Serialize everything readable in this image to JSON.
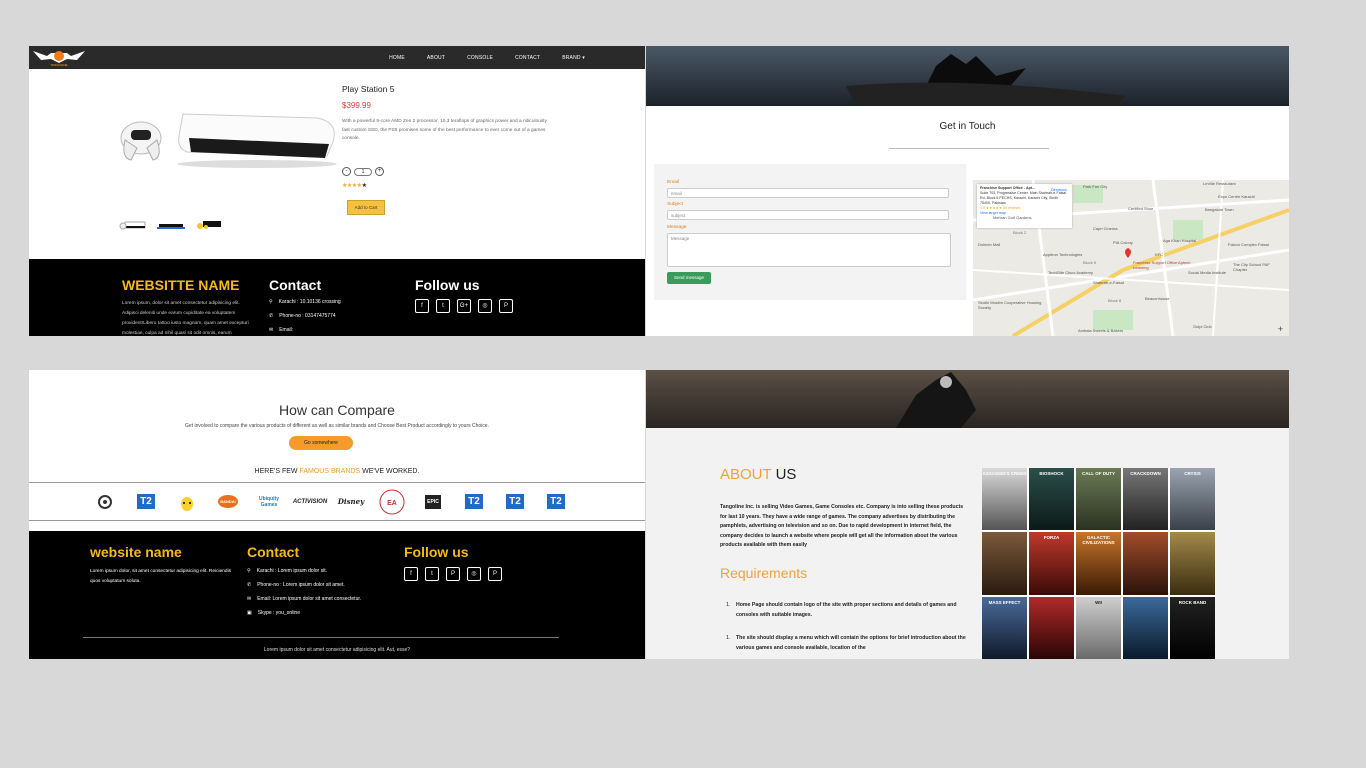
{
  "panel1": {
    "nav": [
      "HOME",
      "ABOUT",
      "CONSOLE",
      "CONTACT",
      "BRAND ▾"
    ],
    "logo_text": "TANGOLINE",
    "product": {
      "title": "Play Station 5",
      "price": "$399.99",
      "description": "With a powerful 8-core AMD Zen 2 processor, 10.3 teraflops of graphics power and a ridiculously fast custom SSD, the PS5 promises some of the best performance to ever come out of a games console.",
      "qty_minus": "-",
      "qty_value": "1",
      "qty_plus": "+",
      "rating": 4,
      "add_to_cart": "Add to Cart"
    },
    "footer": {
      "site_name": "WEBSITTE NAME",
      "about_text": "Lorem ipsum, dolor sit amet consectetur adipisicing elit. Adipisci deleniti unde earum cupiditate ea voluptatem provident!Libero tattoo iusto magnam, quam amet excepturi molestiae, culpa ad nihil quasi sit odit omnis, earum reprehenderit.",
      "contact_title": "Contact",
      "contact": [
        "Karachi : 10.10136 crossing",
        "Phone-no : 03147475774",
        "Email:"
      ],
      "follow_title": "Follow us"
    }
  },
  "panel2": {
    "heading": "Get in Touch",
    "form": {
      "email_label": "Email",
      "email_placeholder": "email",
      "subject_label": "Subject",
      "subject_placeholder": "subject",
      "message_label": "Message",
      "message_placeholder": "Message",
      "send": "Send message"
    },
    "map": {
      "card_title": "Franchise Support Office - Apt...",
      "card_address": "Suite 703, Progressive Center, Main Shahrah-e-Faisal Rd, Block 6 PECHS, Karachi, Karachi City, Sindh 75400, Pakistan",
      "card_rating": "4.9 ★★★★★  50 reviews",
      "card_link": "View larger map",
      "directions": "Directions",
      "labels": [
        "Park Fun City",
        "LeVille Restaurant",
        "Expo Centre Karachi",
        "Bangalore Town",
        "Certified Shoe",
        "Aga Khan Hospital",
        "Capri Cinema",
        "PIA Colony",
        "KFC",
        "Franchise Support Office Aptech Learning",
        "Falcon Complex Faisal",
        "Shahrah-e-Faisal",
        "Sindhi Muslim Cooperative Housing Society",
        "Beaconhouse",
        "TechElite Cisco Academy",
        "Appitron Technologies",
        "Dolmen Mall",
        "Ambala Sweets & Bakers",
        "Gulpi Club",
        "Mehran Golf Gardens",
        "Block 6",
        "Block 2",
        "Block 8",
        "Social Media Institute",
        "The City School PAF Chapter"
      ],
      "zoom": "+"
    }
  },
  "panel3": {
    "heading": "How can Compare",
    "subheading": "Get involved to compare the various products of different as well as similar brands and Choose Best Product accordingly to yours Choice.",
    "button": "Go somewhere",
    "brands_title_pre": "HERE'S FEW ",
    "brands_title_hl": "FAMOUS BRANDS",
    "brands_title_post": " WE'VE WORKED.",
    "brands": [
      "Ubisoft",
      "T2",
      "Pikachu",
      "Bandai Namco",
      "Ubiquity Games",
      "ACTIVISION",
      "Disney",
      "EA Sports",
      "EPIC GAMES",
      "T2",
      "T2",
      "T2"
    ],
    "footer": {
      "site_name": "website name",
      "about_text": "Lorem ipsum dolor, sit amet consectetur adipisicing elit. Reiciendis quos voluptatum soluta.",
      "contact_title": "Contact",
      "contact": [
        "Karachi : Lorem ipsum dolor sit.",
        "Phone-no : Lorem ipsum dolor sit amet.",
        "Email: Lorem ipsum dolor sit amet consectetur.",
        "Skype : you_online"
      ],
      "follow_title": "Follow us",
      "copyright": "Lorem ipsum dolor sit amet consectetur adipisicing elit. Aut, esse?"
    }
  },
  "panel4": {
    "about_a": "ABOUT",
    "about_b": "US",
    "about_text": "Tangoline Inc. is selling Video Games, Game Consoles etc. Company is into selling these products for last 10 years. They have a wide range of games. The company advertises by distributing the pamphlets, advertising on television and so on. Due to rapid development in internet field, the company decides to launch a website where people will get all the information about the various products available with them easily",
    "requirements_title": "Requirements",
    "requirements": [
      {
        "n": "1.",
        "text": "Home Page should contain logo of the site with proper sections and details of games and consoles with suitable images."
      },
      {
        "n": "1.",
        "text": "The site should display a menu which will contain the options for brief introduction about the various games and console available, location of the"
      }
    ],
    "covers": [
      "ASSASSIN'S CREED",
      "BIOSHOCK",
      "CALL OF DUTY",
      "CRACKDOWN",
      "CRYSIS",
      "",
      "FORZA",
      "GALACTIC CIVILIZATIONS",
      "",
      "",
      "MASS EFFECT",
      "",
      "WII",
      "",
      "ROCK BAND"
    ]
  },
  "colors": {
    "accent": "#f8b818",
    "orange": "#f79a2c",
    "send": "#3a9b5a",
    "price": "#e23b2e"
  }
}
